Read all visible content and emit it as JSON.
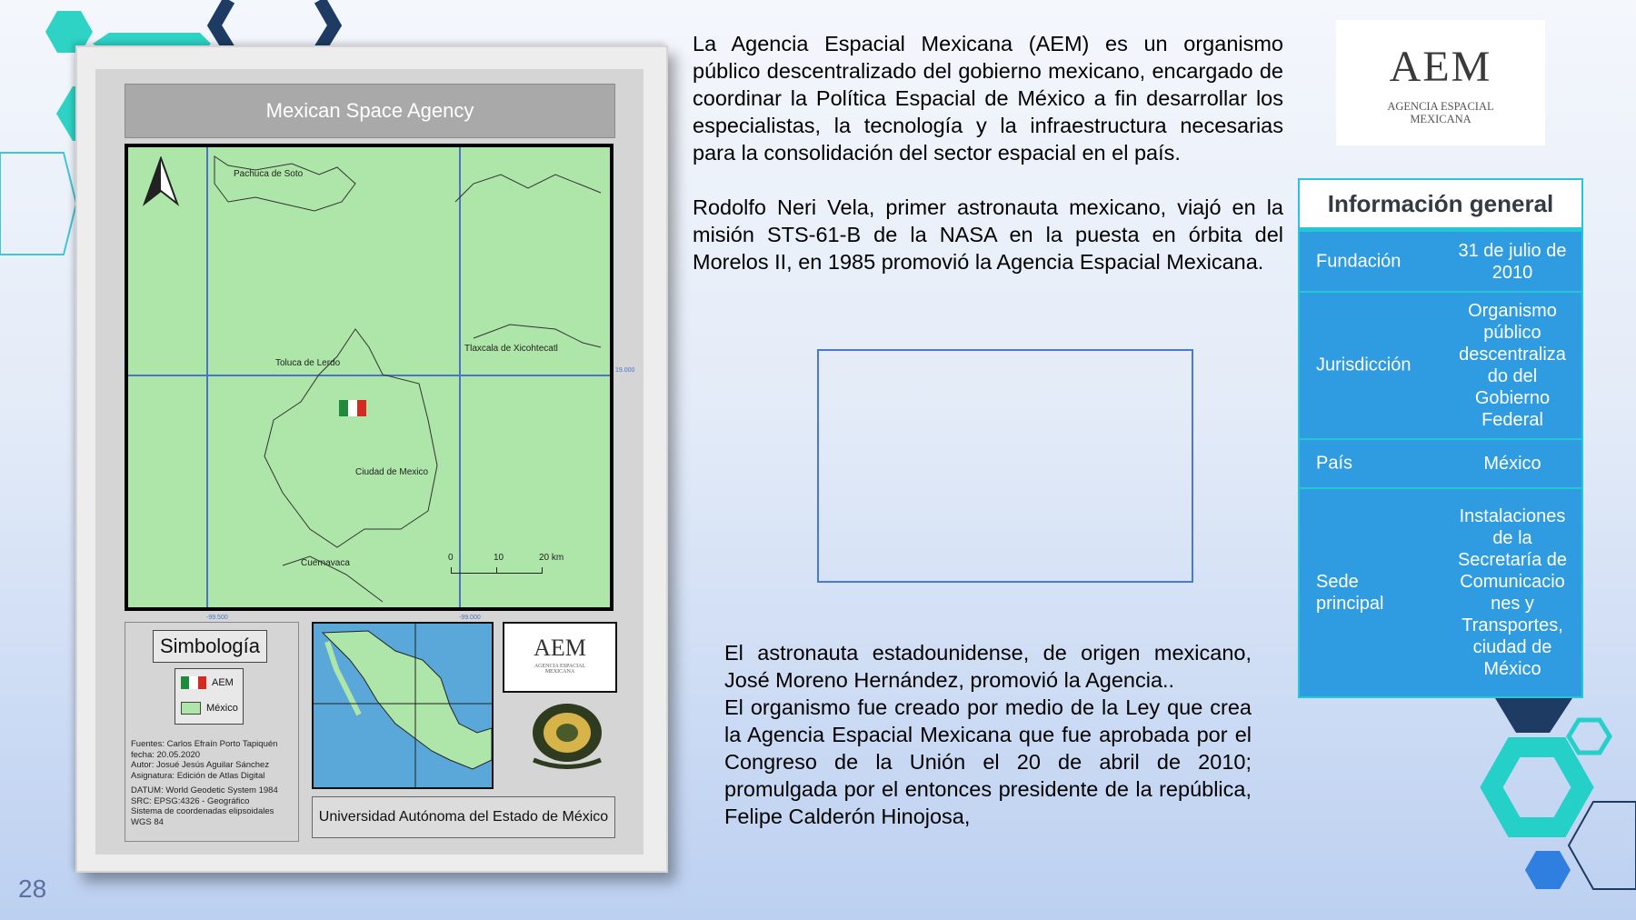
{
  "slide": {
    "page_number": "28"
  },
  "map_card": {
    "title": "Mexican Space Agency",
    "places": {
      "pachuca": "Pachuca de Soto",
      "toluca": "Toluca de Lerdo",
      "tlaxcala": "Tlaxcala de Xicohtecatl",
      "cdmx": "Ciudad de Mexico",
      "cuernavaca": "Cuernavaca"
    },
    "coordinates": {
      "x1": "-99.500",
      "x2": "-99.000",
      "y1": "19.000"
    },
    "scale_bar": {
      "t0": "0",
      "t1": "10",
      "t2": "20 km"
    },
    "legend": {
      "title": "Simbología",
      "item_aem": "AEM",
      "item_mexico": "México",
      "sources": [
        "Fuentes: Carlos Efraín Porto Tapiquén",
        "fecha: 20.05.2020",
        "Autor: Josué Jesús Aguilar Sánchez",
        "Asignatura: Edición de Atlas Digital",
        "DATUM: World Geodetic System 1984",
        "SRC: EPSG:4326 - Geográfico",
        "Sistema de coordenadas elipsoidales",
        "WGS 84"
      ]
    },
    "inset_logo_main": "AEM",
    "inset_logo_sub": "AGENCIA ESPACIAL MEXICANA",
    "university": "Universidad Autónoma del Estado de México"
  },
  "text": {
    "paragraph_1": "La Agencia Espacial Mexicana (AEM) es un organismo público descentralizado del gobierno mexicano, encargado de coordinar la Política Espacial de México a fin desarrollar los especialistas, la tecnología y la infraestructura necesarias para la consolidación del sector espacial en el país.",
    "paragraph_2": "Rodolfo Neri Vela, primer astronauta mexicano, viajó en la misión STS-61-B de la NASA en la puesta en órbita del Morelos II, en 1985 promovió la Agencia Espacial Mexicana.",
    "paragraph_3": "El astronauta estadounidense, de origen mexicano, José Moreno Hernández, promovió la Agencia..",
    "paragraph_4": "El organismo fue creado por medio de la Ley que crea la Agencia Espacial Mexicana que fue aprobada por el Congreso de la Unión el 20 de abril de 2010; promulgada por el entonces presidente de la república, Felipe Calderón Hinojosa,"
  },
  "logo": {
    "main": "AEM",
    "line1": "AGENCIA ESPACIAL",
    "line2": "MEXICANA"
  },
  "info_table": {
    "title": "Información general",
    "rows": [
      {
        "key": "Fundación",
        "value": "31 de julio de 2010"
      },
      {
        "key": "Jurisdicción",
        "value": "Organismo público descentraliza do del Gobierno Federal"
      },
      {
        "key": "País",
        "value": "México"
      },
      {
        "key": "Sede principal",
        "value": "Instalaciones de la Secretaría de Comunicacio nes y Transportes, ciudad de México"
      }
    ]
  },
  "colors": {
    "accent_teal": "#25c7d6",
    "panel_blue": "#2f9be1",
    "navy": "#1e3c63",
    "map_green": "#aee5a8"
  }
}
